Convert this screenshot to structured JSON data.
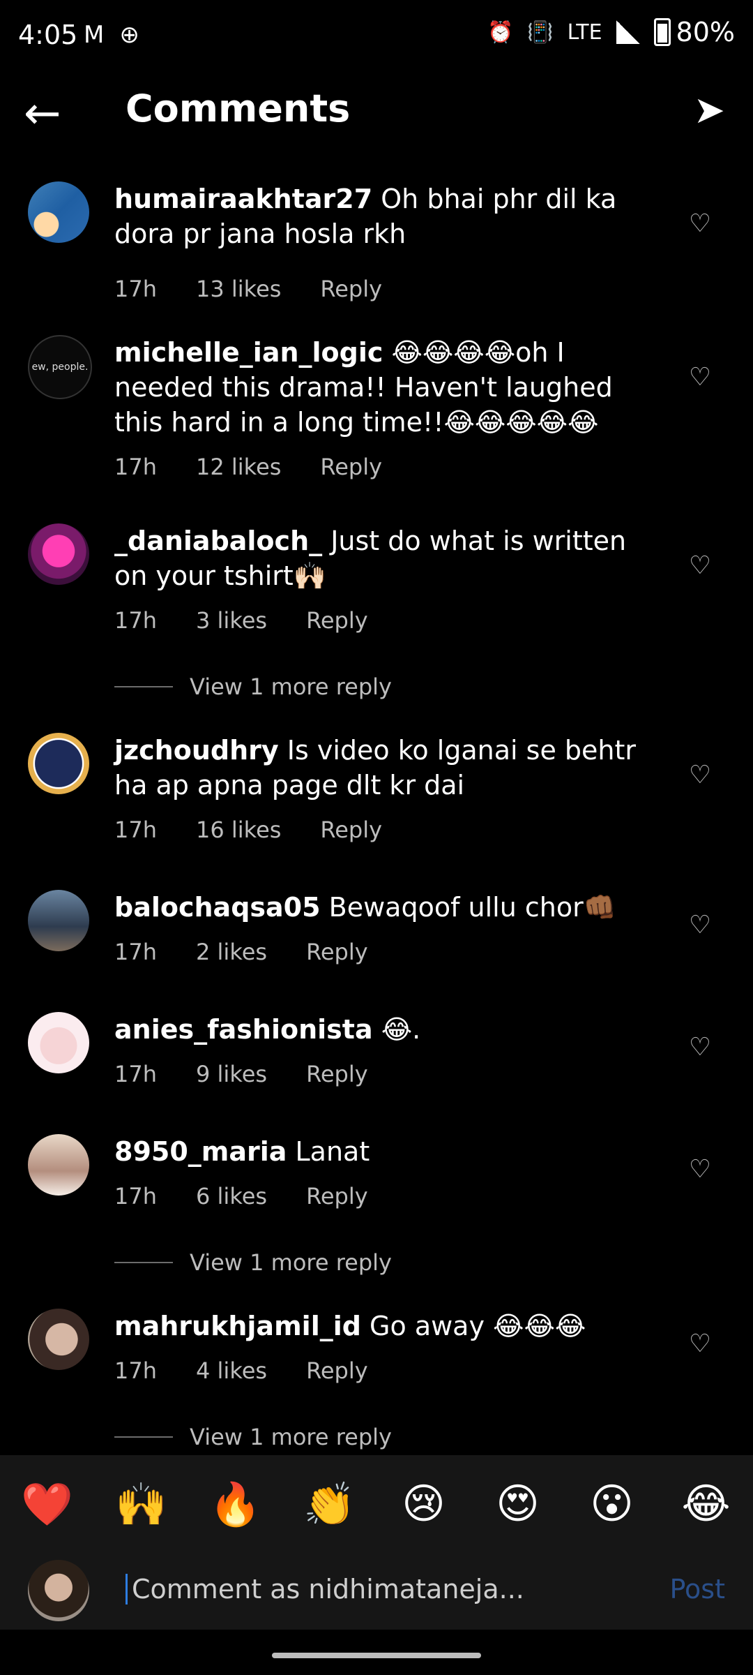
{
  "status_bar": {
    "time": "4:05",
    "left_icons": [
      "gmail-icon",
      "app-icon"
    ],
    "right_icons": [
      "alarm-icon",
      "vibrate-icon",
      "volte-icon",
      "signal-4g-icon",
      "battery-icon"
    ],
    "battery_text": "80%"
  },
  "header": {
    "title": "Comments",
    "back_icon": "arrow-left-icon",
    "share_icon": "paper-plane-icon"
  },
  "comments": [
    {
      "username": "humairaakhtar27",
      "text": "Oh bhai phr dil ka dora pr jana hosla rkh",
      "time": "17h",
      "likes": "13 likes",
      "reply": "Reply"
    },
    {
      "username": "michelle_ian_logic",
      "text": "😂😂😂😂oh I needed this drama!! Haven't laughed this hard in a long time!!😂😂😂😂😂",
      "time": "17h",
      "likes": "12 likes",
      "reply": "Reply",
      "avatar_text": "ew, people."
    },
    {
      "username": "_daniabaloch_",
      "text": "Just do what is written on your tshirt🙌🏻",
      "time": "17h",
      "likes": "3 likes",
      "reply": "Reply",
      "view_more": "View 1 more reply"
    },
    {
      "username": "jzchoudhry",
      "text": "Is video ko lganai se behtr ha ap apna page dlt kr dai",
      "time": "17h",
      "likes": "16 likes",
      "reply": "Reply"
    },
    {
      "username": "balochaqsa05",
      "text": "Bewaqoof ullu chor👊🏾",
      "time": "17h",
      "likes": "2 likes",
      "reply": "Reply"
    },
    {
      "username": "anies_fashionista",
      "text": "😂.",
      "time": "17h",
      "likes": "9 likes",
      "reply": "Reply"
    },
    {
      "username": "8950_maria",
      "text": "Lanat",
      "time": "17h",
      "likes": "6 likes",
      "reply": "Reply",
      "view_more": "View 1 more reply"
    },
    {
      "username": "mahrukhjamil_id",
      "text": "Go away 😂😂😂",
      "time": "17h",
      "likes": "4 likes",
      "reply": "Reply",
      "view_more": "View 1 more reply"
    }
  ],
  "reactions": [
    "❤️",
    "🙌",
    "🔥",
    "👏",
    "😢",
    "😍",
    "😮",
    "😂"
  ],
  "composer": {
    "placeholder": "Comment as nidhimataneja...",
    "post_label": "Post"
  }
}
